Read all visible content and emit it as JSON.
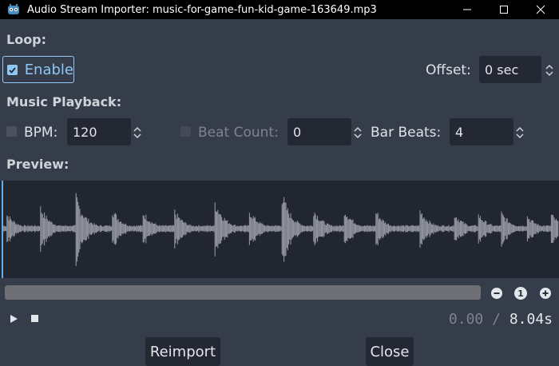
{
  "window": {
    "title": "Audio Stream Importer: music-for-game-fun-kid-game-163649.mp3",
    "app_icon": "godot-icon",
    "buttons": [
      "minimize-icon",
      "maximize-icon",
      "close-icon"
    ]
  },
  "loop": {
    "section_label": "Loop:",
    "enable_label": "Enable",
    "enable_checked": true,
    "offset_label": "Offset:",
    "offset_value": "0 sec"
  },
  "music_playback": {
    "section_label": "Music Playback:",
    "bpm_label": "BPM:",
    "bpm_checked": false,
    "bpm_value": "120",
    "beat_count_label": "Beat Count:",
    "beat_count_checked": false,
    "beat_count_value": "0",
    "bar_beats_label": "Bar Beats:",
    "bar_beats_value": "4"
  },
  "preview": {
    "section_label": "Preview:",
    "zoom_out_icon": "minus-circle-icon",
    "zoom_reset_label": "1",
    "zoom_in_icon": "plus-circle-icon",
    "play_icon": "play-icon",
    "stop_icon": "stop-icon",
    "current_time": "0.00",
    "separator": "/",
    "duration": "8.04s"
  },
  "footer": {
    "reimport_label": "Reimport",
    "close_label": "Close"
  },
  "colors": {
    "background": "#363d4a",
    "accent": "#8fc8f4",
    "field": "#242833",
    "waveform": "#9a9ea6"
  }
}
